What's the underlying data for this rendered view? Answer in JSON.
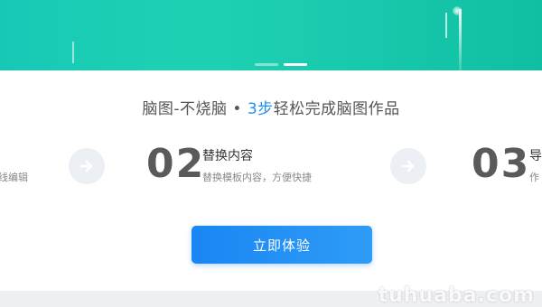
{
  "headline": {
    "prefix": "脑图-不烧脑 • ",
    "accent": "3步",
    "suffix": "轻松完成脑图作品"
  },
  "steps": [
    {
      "desc": "线编辑"
    },
    {
      "number": "02",
      "title": "替换内容",
      "desc": "替换模板内容，方便快捷"
    },
    {
      "number": "03",
      "title": "导",
      "desc": "作"
    }
  ],
  "cta": {
    "label": "立即体验"
  },
  "carousel": {
    "count": 2,
    "active_index": 1
  },
  "icons": {
    "arrow": "arrow-right-icon"
  },
  "colors": {
    "hero": "#1fd1b3",
    "accent": "#1e8ff2",
    "cta": "#1a86f3"
  },
  "watermark": "tuhuaba.com"
}
